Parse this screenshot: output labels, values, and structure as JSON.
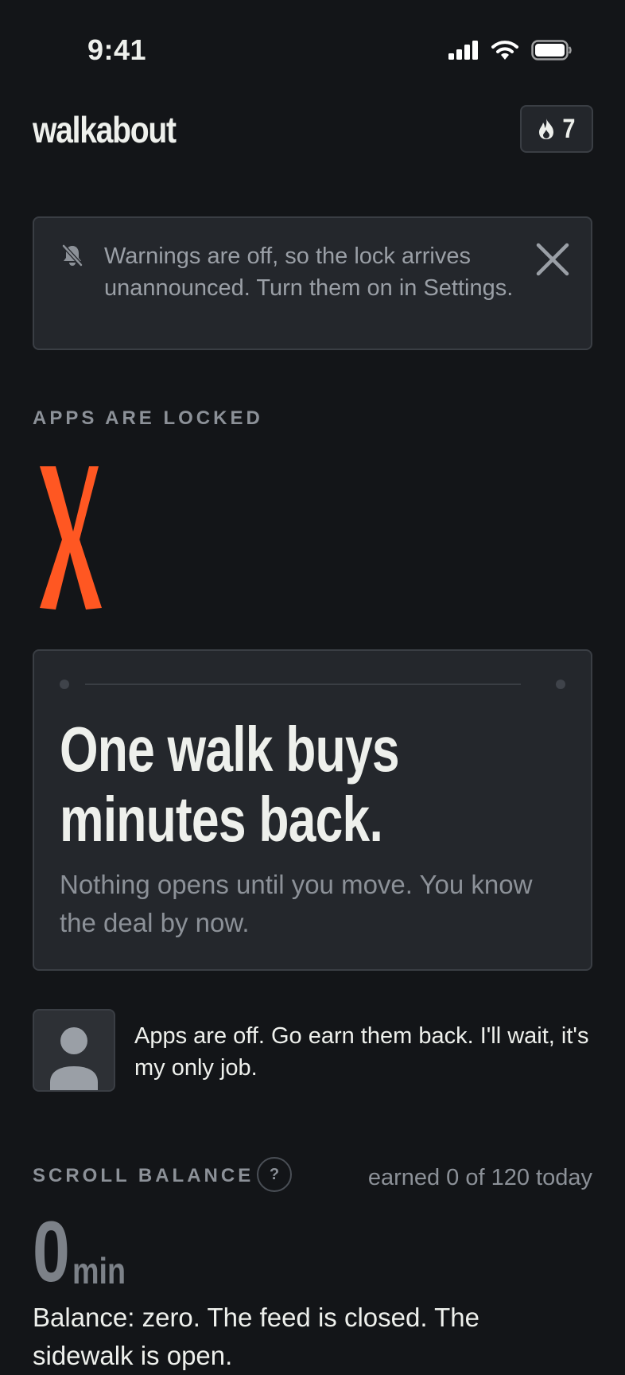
{
  "status_bar": {
    "time": "9:41"
  },
  "header": {
    "app_title": "walkabout",
    "streak_count": "7"
  },
  "warning_banner": {
    "text": "Warnings are off, so the lock arrives unannounced. Turn them on in Settings."
  },
  "lock_section": {
    "label": "APPS ARE LOCKED"
  },
  "hero_card": {
    "title_line1": "One walk buys",
    "title_line2": "minutes back.",
    "subtitle": "Nothing opens until you move. You know the deal by now."
  },
  "coach": {
    "message": "Apps are off. Go earn them back. I'll wait, it's my only job."
  },
  "balance": {
    "label": "SCROLL BALANCE",
    "help_label": "?",
    "earned_text": "earned 0 of 120 today",
    "value": "0",
    "unit": "min",
    "message": "Balance: zero. The feed is closed. The sidewalk is open."
  },
  "colors": {
    "background": "#131518",
    "card": "#24272c",
    "accent_orange": "#ff5722",
    "text_primary": "#eef0ec",
    "text_muted": "#8c9198"
  },
  "icons": {
    "signal": "cellular-signal-icon",
    "wifi": "wifi-icon",
    "battery": "battery-icon",
    "streak": "flame-icon",
    "warning": "bell-off-icon",
    "close": "close-icon",
    "lock_mark": "x-mark-icon",
    "avatar": "person-icon"
  }
}
